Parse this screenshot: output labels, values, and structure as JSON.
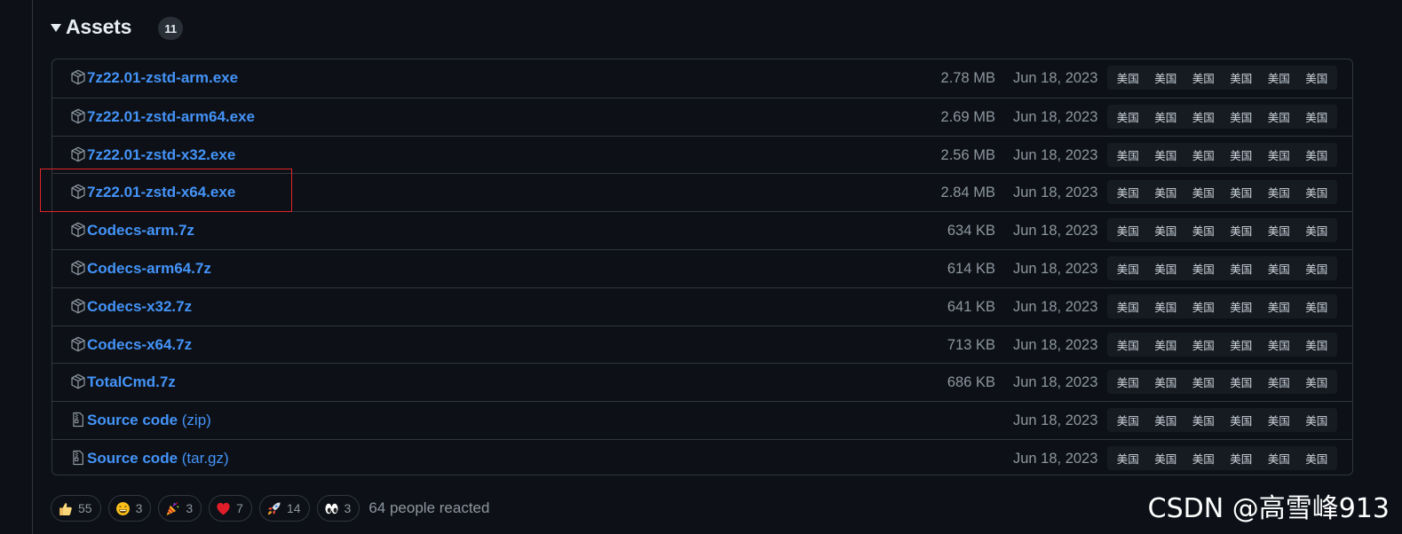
{
  "assets": {
    "title": "Assets",
    "count": "11",
    "mirror_label": "美国",
    "rows": [
      {
        "name": "7z22.01-zstd-arm.exe",
        "suffix": "",
        "size": "2.78 MB",
        "date": "Jun 18, 2023",
        "icon": "package-icon"
      },
      {
        "name": "7z22.01-zstd-arm64.exe",
        "suffix": "",
        "size": "2.69 MB",
        "date": "Jun 18, 2023",
        "icon": "package-icon"
      },
      {
        "name": "7z22.01-zstd-x32.exe",
        "suffix": "",
        "size": "2.56 MB",
        "date": "Jun 18, 2023",
        "icon": "package-icon"
      },
      {
        "name": "7z22.01-zstd-x64.exe",
        "suffix": "",
        "size": "2.84 MB",
        "date": "Jun 18, 2023",
        "icon": "package-icon"
      },
      {
        "name": "Codecs-arm.7z",
        "suffix": "",
        "size": "634 KB",
        "date": "Jun 18, 2023",
        "icon": "package-icon"
      },
      {
        "name": "Codecs-arm64.7z",
        "suffix": "",
        "size": "614 KB",
        "date": "Jun 18, 2023",
        "icon": "package-icon"
      },
      {
        "name": "Codecs-x32.7z",
        "suffix": "",
        "size": "641 KB",
        "date": "Jun 18, 2023",
        "icon": "package-icon"
      },
      {
        "name": "Codecs-x64.7z",
        "suffix": "",
        "size": "713 KB",
        "date": "Jun 18, 2023",
        "icon": "package-icon"
      },
      {
        "name": "TotalCmd.7z",
        "suffix": "",
        "size": "686 KB",
        "date": "Jun 18, 2023",
        "icon": "package-icon"
      },
      {
        "name": "Source code",
        "suffix": " (zip)",
        "size": "",
        "date": "Jun 18, 2023",
        "icon": "file-zip-icon"
      },
      {
        "name": "Source code",
        "suffix": " (tar.gz)",
        "size": "",
        "date": "Jun 18, 2023",
        "icon": "file-zip-icon"
      }
    ]
  },
  "reactions": {
    "items": [
      {
        "emoji": "thumbs-up-icon",
        "count": "55"
      },
      {
        "emoji": "laugh-icon",
        "count": "3"
      },
      {
        "emoji": "hooray-icon",
        "count": "3"
      },
      {
        "emoji": "heart-icon",
        "count": "7"
      },
      {
        "emoji": "rocket-icon",
        "count": "14"
      },
      {
        "emoji": "eyes-icon",
        "count": "3"
      }
    ],
    "summary": "64 people reacted"
  },
  "watermark": "CSDN @高雪峰913",
  "colors": {
    "background": "#0d1117",
    "link": "#4493f8",
    "muted": "#8d96a0",
    "border": "#30363d",
    "highlight": "#e0252a"
  }
}
